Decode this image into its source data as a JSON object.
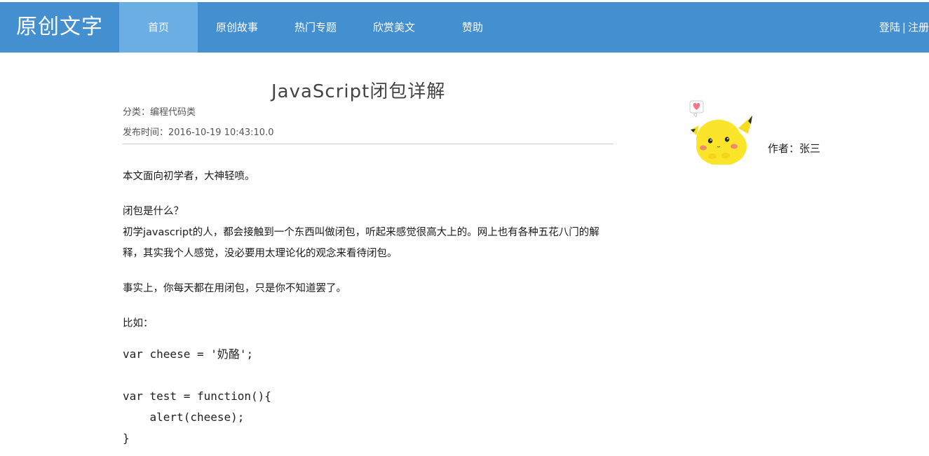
{
  "header": {
    "brand": "原创文字",
    "nav": [
      {
        "label": "首页",
        "active": true
      },
      {
        "label": "原创故事",
        "active": false
      },
      {
        "label": "热门专题",
        "active": false
      },
      {
        "label": "欣赏美文",
        "active": false
      },
      {
        "label": "赞助",
        "active": false
      }
    ],
    "login": "登陆",
    "separator": "|",
    "register": "注册"
  },
  "article": {
    "title": "JavaScript闭包详解",
    "category": "分类：编程代码类",
    "published": "发布时间：2016-10-19 10:43:10.0",
    "paragraphs": [
      "本文面向初学者，大神轻喷。",
      "闭包是什么？\n初学javascript的人，都会接触到一个东西叫做闭包，听起来感觉很高大上的。网上也有各种五花八门的解释，其实我个人感觉，没必要用太理论化的观念来看待闭包。",
      "事实上，你每天都在用闭包，只是你不知道罢了。",
      "比如："
    ],
    "code": "var cheese = '奶酪';\n\nvar test = function(){\n    alert(cheese);\n}"
  },
  "sidebar": {
    "author": "作者：张三",
    "avatar_icon": "pikachu-avatar-icon"
  },
  "colors": {
    "header_bg": "#438fcf",
    "active_nav_bg": "#6aaee3"
  }
}
